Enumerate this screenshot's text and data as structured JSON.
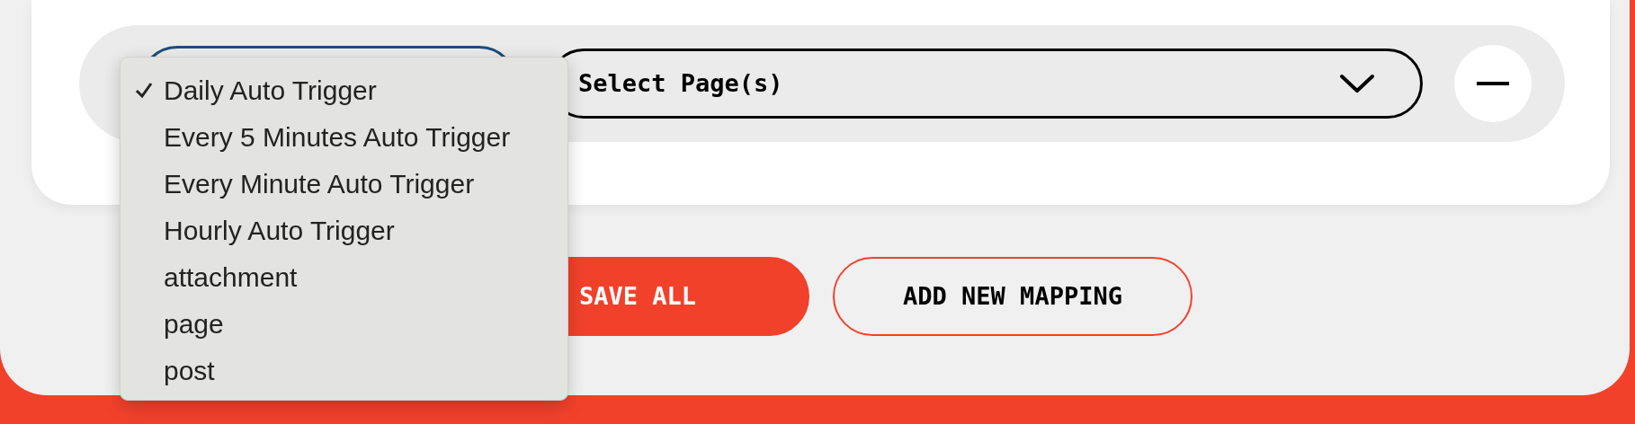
{
  "mapping_row": {
    "trigger_select": {
      "open": true,
      "options": [
        {
          "label": "Daily Auto Trigger",
          "selected": true
        },
        {
          "label": "Every 5 Minutes Auto Trigger",
          "selected": false
        },
        {
          "label": "Every Minute Auto Trigger",
          "selected": false
        },
        {
          "label": "Hourly Auto Trigger",
          "selected": false
        },
        {
          "label": "attachment",
          "selected": false
        },
        {
          "label": "page",
          "selected": false
        },
        {
          "label": "post",
          "selected": false
        }
      ]
    },
    "page_select": {
      "placeholder": "Select Page(s)"
    }
  },
  "buttons": [
    {
      "label": "SAVE ALL",
      "kind": "primary"
    },
    {
      "label": "ADD NEW MAPPING",
      "kind": "outline"
    }
  ]
}
